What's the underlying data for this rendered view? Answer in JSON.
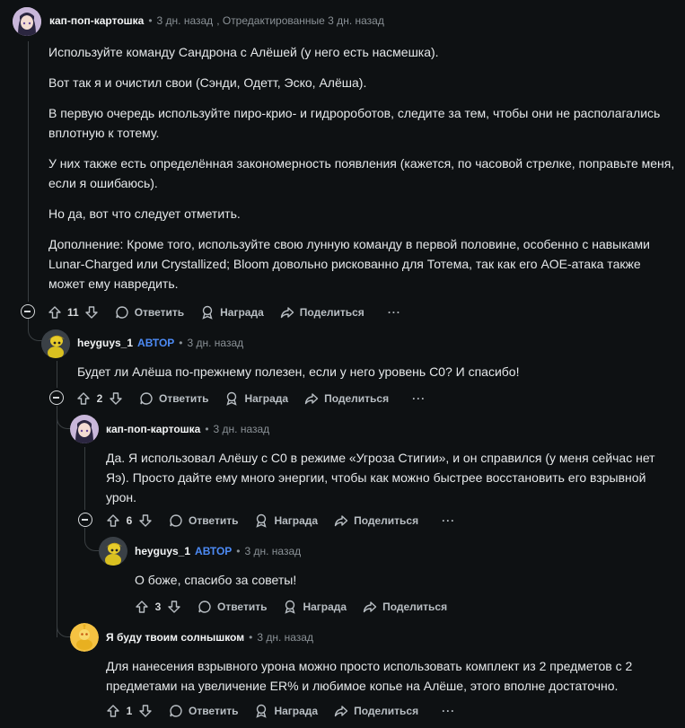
{
  "comments": [
    {
      "user": "кап-поп-картошка",
      "time": "3 дн. назад",
      "edited": ", Отредактированные 3 дн. назад",
      "paragraphs": [
        "Используйте команду Сандрона с Алёшей (у него есть насмешка).",
        "Вот так я и очистил свои (Сэнди, Одетт, Эско, Алёша).",
        "В первую очередь используйте пиро-крио- и гидророботов, следите за тем, чтобы они не располагались вплотную к тотему.",
        "У них также есть определённая закономерность появления (кажется, по часовой стрелке, поправьте меня, если я ошибаюсь).",
        "Но да, вот что следует отметить.",
        "Дополнение: Кроме того, используйте свою лунную команду в первой половине, особенно с навыками Lunar-Charged или Crystallized; Bloom довольно рискованно для Тотема, так как его AOE-атака также может ему навредить."
      ],
      "votes": "11"
    },
    {
      "user": "heyguys_1",
      "op": "АВТОР",
      "time": "3 дн. назад",
      "paragraphs": [
        "Будет ли Алёша по-прежнему полезен, если у него уровень C0? И спасибо!"
      ],
      "votes": "2"
    },
    {
      "user": "кап-поп-картошка",
      "time": "3 дн. назад",
      "paragraphs": [
        "Да. Я использовал Алёшу с C0 в режиме «Угроза Стигии», и он справился (у меня сейчас нет Яэ). Просто дайте ему много энергии, чтобы как можно быстрее восстановить его взрывной урон."
      ],
      "votes": "6"
    },
    {
      "user": "heyguys_1",
      "op": "АВТОР",
      "time": "3 дн. назад",
      "paragraphs": [
        "О боже, спасибо за советы!"
      ],
      "votes": "3"
    },
    {
      "user": "Я буду твоим солнышком",
      "time": "3 дн. назад",
      "paragraphs": [
        "Для нанесения взрывного урона можно просто использовать комплект из 2 предметов с 2 предметами на увеличение ER% и любимое копье на Алёше, этого вполне достаточно."
      ],
      "votes": "1"
    }
  ],
  "actions": {
    "reply": "Ответить",
    "award": "Награда",
    "share": "Поделиться",
    "more": "···"
  },
  "separator": "•"
}
